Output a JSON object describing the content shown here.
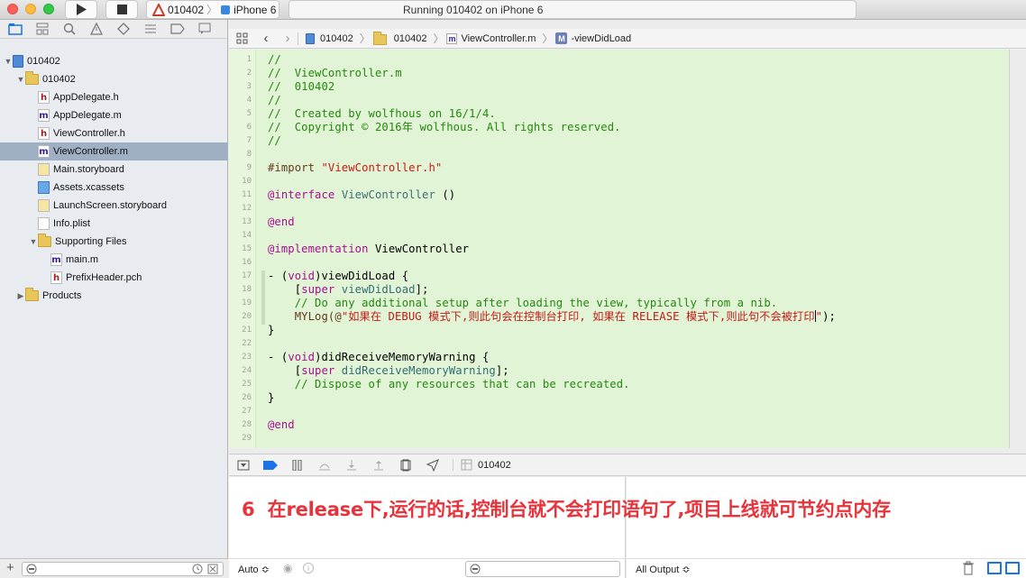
{
  "window": {
    "scheme_target": "010402",
    "scheme_device": "iPhone 6",
    "activity_status": "Running 010402 on iPhone 6"
  },
  "navigator": {
    "items": [
      {
        "label": "010402",
        "kind": "project",
        "level": 0,
        "expanded": true
      },
      {
        "label": "010402",
        "kind": "folder",
        "level": 1,
        "expanded": true
      },
      {
        "label": "AppDelegate.h",
        "kind": "h",
        "level": 2
      },
      {
        "label": "AppDelegate.m",
        "kind": "m",
        "level": 2
      },
      {
        "label": "ViewController.h",
        "kind": "h",
        "level": 2
      },
      {
        "label": "ViewController.m",
        "kind": "m",
        "level": 2,
        "selected": true
      },
      {
        "label": "Main.storyboard",
        "kind": "storyboard",
        "level": 2
      },
      {
        "label": "Assets.xcassets",
        "kind": "xcassets",
        "level": 2
      },
      {
        "label": "LaunchScreen.storyboard",
        "kind": "storyboard",
        "level": 2
      },
      {
        "label": "Info.plist",
        "kind": "plist",
        "level": 2
      },
      {
        "label": "Supporting Files",
        "kind": "folder",
        "level": 2,
        "expanded": true
      },
      {
        "label": "main.m",
        "kind": "m",
        "level": 3
      },
      {
        "label": "PrefixHeader.pch",
        "kind": "h",
        "level": 3
      },
      {
        "label": "Products",
        "kind": "folder",
        "level": 1,
        "expanded": false
      }
    ],
    "h_glyph": "h",
    "m_glyph": "m",
    "filter_add_glyph": "+"
  },
  "jumpbar": {
    "crumbs": [
      "010402",
      "010402",
      "ViewController.m",
      "-viewDidLoad"
    ],
    "method_badge": "M",
    "file_badge": "m"
  },
  "editor": {
    "line_numbers": [
      "1",
      "2",
      "3",
      "4",
      "5",
      "6",
      "7",
      "8",
      "9",
      "10",
      "11",
      "12",
      "13",
      "14",
      "15",
      "16",
      "17",
      "18",
      "19",
      "20",
      "21",
      "22",
      "23",
      "24",
      "25",
      "26",
      "27",
      "28",
      "29"
    ],
    "comment_lines": [
      "//",
      "//  ViewController.m",
      "//  010402",
      "//",
      "//  Created by wolfhous on 16/1/4.",
      "//  Copyright © 2016年 wolfhous. All rights reserved.",
      "//"
    ],
    "import_kw": "#import",
    "import_str": "\"ViewController.h\"",
    "interface_kw": "@interface",
    "class_name": "ViewController",
    "paren_empty": " ()",
    "end_kw": "@end",
    "implementation_kw": "@implementation",
    "impl_name": " ViewController",
    "m1_prefix": "- (",
    "void_kw": "void",
    "m1_name": ")viewDidLoad {",
    "super_kw": "super",
    "m1_super_call": " viewDidLoad",
    "super_close": "];",
    "m1_comment": "// Do any additional setup after loading the view, typically from a nib.",
    "mylog_open": "MYLog(@",
    "mylog_string": "\"如果在 DEBUG 模式下,则此句会在控制台打印, 如果在 RELEASE 模式下,则此句不会被打印",
    "mylog_end": "\"",
    "mylog_close": ");",
    "close_brace": "}",
    "m2_name": ")didReceiveMemoryWarning {",
    "m2_super_call": " didReceiveMemoryWarning",
    "m2_comment": "// Dispose of any resources that can be recreated."
  },
  "debug": {
    "target": "010402",
    "note_number": "6",
    "note_text": "在release下,运行的话,控制台就不会打印语句了,项目上线就可节约点内存",
    "var_scope": "Auto ≎",
    "console_output": "All Output ≎"
  },
  "colors": {
    "editor_bg": "#e1f4d5",
    "note_red": "#e9333b",
    "selection": "#9fb0c4"
  }
}
